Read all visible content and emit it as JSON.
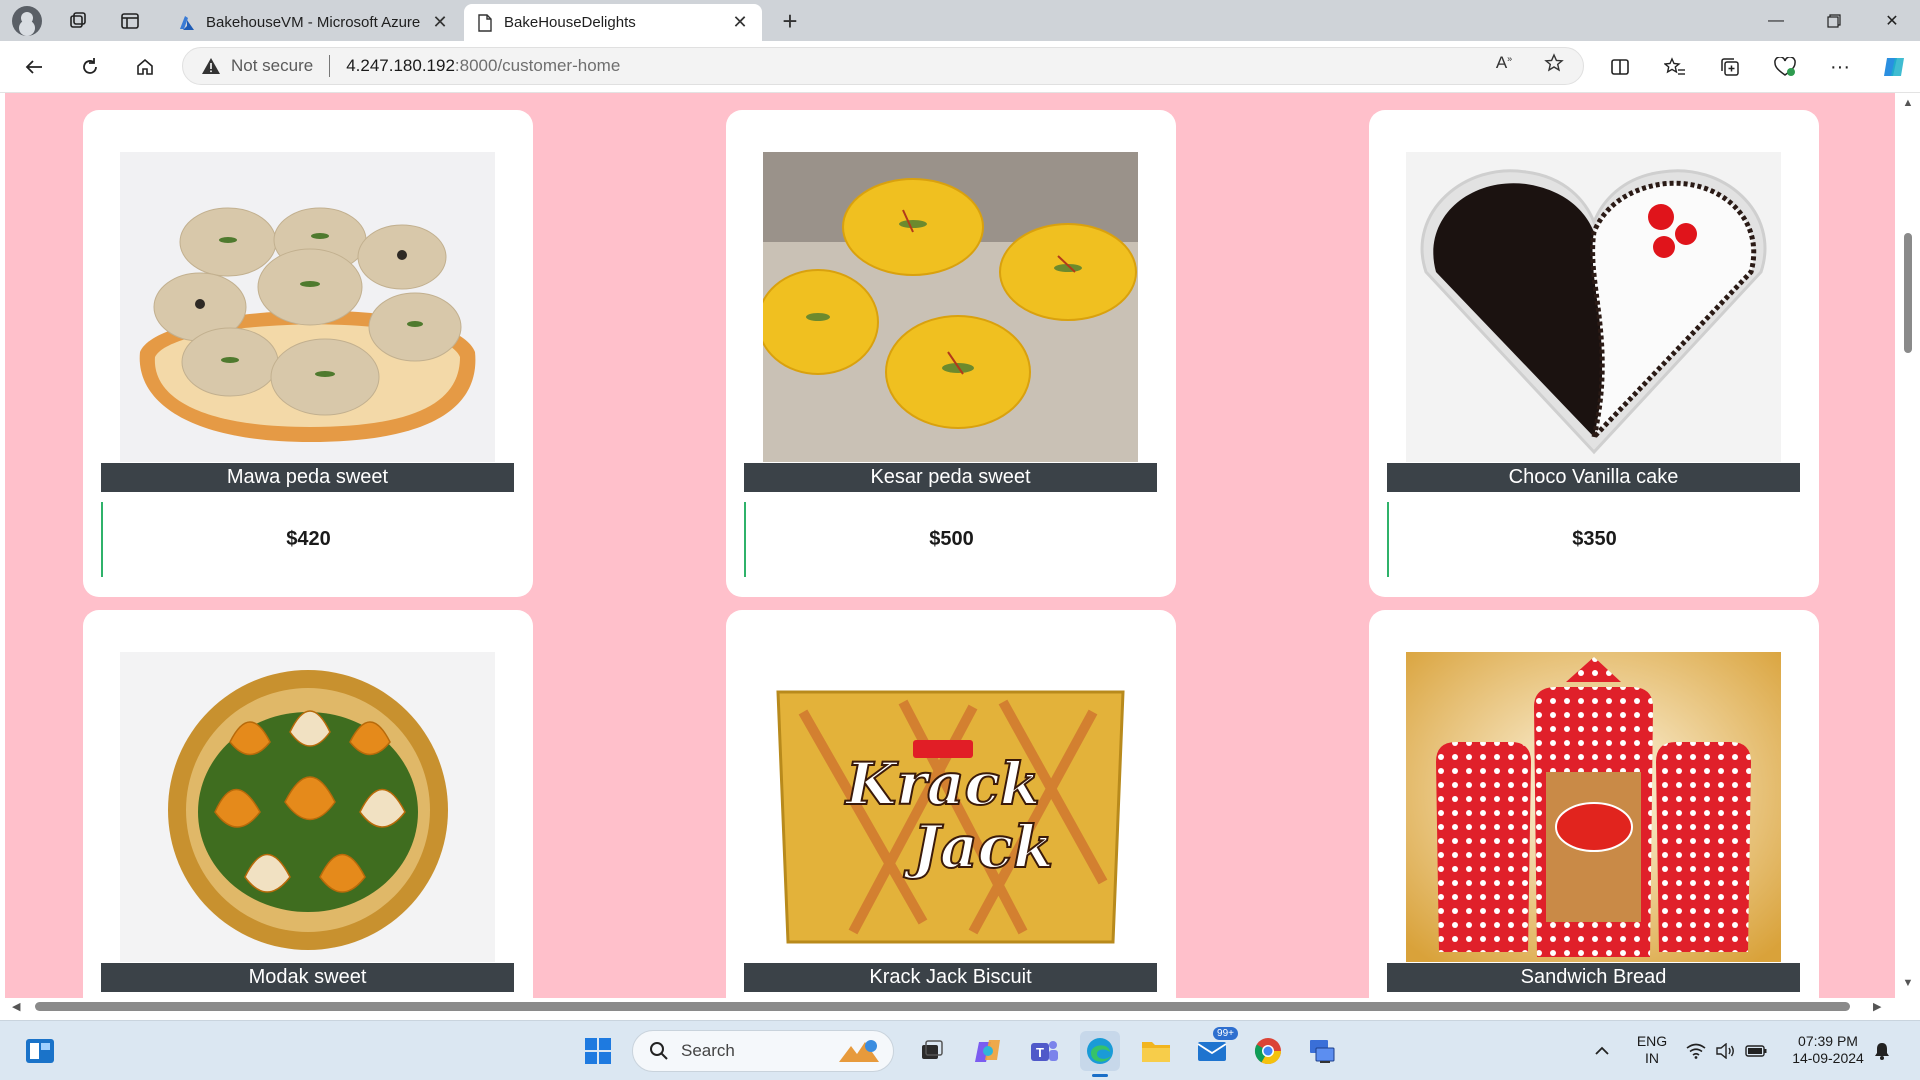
{
  "browser": {
    "tabs": [
      {
        "title": "BakehouseVM - Microsoft Azure",
        "active": false
      },
      {
        "title": "BakeHouseDelights",
        "active": true
      }
    ],
    "address": {
      "security_label": "Not secure",
      "url_host": "4.247.180.192",
      "url_rest": ":8000/customer-home"
    }
  },
  "products": [
    {
      "name": "Mawa peda sweet",
      "price": "$420",
      "image": "mawa-peda"
    },
    {
      "name": "Kesar peda sweet",
      "price": "$500",
      "image": "kesar-peda"
    },
    {
      "name": "Choco Vanilla cake",
      "price": "$350",
      "image": "choco-vanilla-cake"
    },
    {
      "name": "Modak sweet",
      "image": "modak"
    },
    {
      "name": "Krack Jack Biscuit",
      "image": "krack-jack"
    },
    {
      "name": "Sandwich Bread",
      "image": "sandwich-bread"
    }
  ],
  "taskbar": {
    "search_label": "Search",
    "mail_badge": "99+",
    "lang_line1": "ENG",
    "lang_line2": "IN",
    "time": "07:39 PM",
    "date": "14-09-2024"
  },
  "colors": {
    "page_background": "#ffc0cb",
    "card_caption": "#3b4248",
    "price_accent": "#2fb26a"
  }
}
